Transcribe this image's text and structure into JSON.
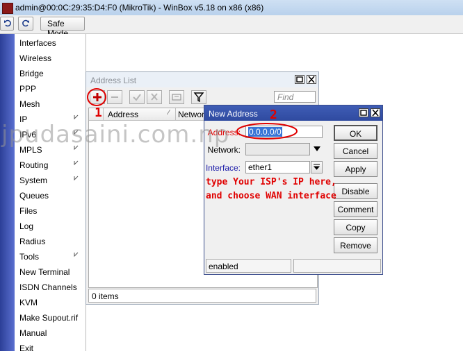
{
  "window": {
    "title": "admin@00:0C:29:35:D4:F0 (MikroTik) - WinBox v5.18 on x86 (x86)"
  },
  "toolbar": {
    "undo_icon": "undo-icon",
    "redo_icon": "redo-icon",
    "safe_mode_label": "Safe Mode"
  },
  "sidebar": {
    "items": [
      {
        "label": "Interfaces",
        "submenu": false
      },
      {
        "label": "Wireless",
        "submenu": false
      },
      {
        "label": "Bridge",
        "submenu": false
      },
      {
        "label": "PPP",
        "submenu": false
      },
      {
        "label": "Mesh",
        "submenu": false
      },
      {
        "label": "IP",
        "submenu": true
      },
      {
        "label": "IPv6",
        "submenu": true
      },
      {
        "label": "MPLS",
        "submenu": true
      },
      {
        "label": "Routing",
        "submenu": true
      },
      {
        "label": "System",
        "submenu": true
      },
      {
        "label": "Queues",
        "submenu": false
      },
      {
        "label": "Files",
        "submenu": false
      },
      {
        "label": "Log",
        "submenu": false
      },
      {
        "label": "Radius",
        "submenu": false
      },
      {
        "label": "Tools",
        "submenu": true
      },
      {
        "label": "New Terminal",
        "submenu": false
      },
      {
        "label": "ISDN Channels",
        "submenu": false
      },
      {
        "label": "KVM",
        "submenu": false
      },
      {
        "label": "Make Supout.rif",
        "submenu": false
      },
      {
        "label": "Manual",
        "submenu": false
      },
      {
        "label": "Exit",
        "submenu": false
      }
    ]
  },
  "address_list": {
    "title": "Address List",
    "find_placeholder": "Find",
    "columns": [
      "Address",
      "Network"
    ],
    "status": "0 items"
  },
  "new_address": {
    "title": "New Address",
    "address_label": "Address:",
    "address_value": "0.0.0.0/0",
    "network_label": "Network:",
    "network_value": "",
    "interface_label": "Interface:",
    "interface_value": "ether1",
    "buttons": {
      "ok": "OK",
      "cancel": "Cancel",
      "apply": "Apply",
      "disable": "Disable",
      "comment": "Comment",
      "copy": "Copy",
      "remove": "Remove"
    },
    "status": "enabled"
  },
  "annotations": {
    "step1": "1",
    "step2": "2",
    "note_line1": "type Your ISP's IP here,",
    "note_line2": "and choose WAN interface",
    "watermark": "jpudasaini.com.np",
    "color": "#e00000"
  }
}
